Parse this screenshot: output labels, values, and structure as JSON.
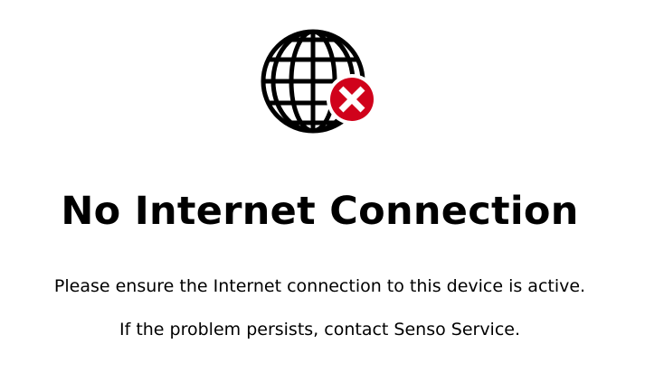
{
  "status": {
    "icon": "globe-error-icon",
    "badge_icon": "close-icon",
    "badge_color": "#d0021b",
    "title": "No Internet Connection",
    "message_primary": "Please ensure the Internet connection to this device is active.",
    "message_secondary": "If the problem persists, contact Senso Service."
  }
}
